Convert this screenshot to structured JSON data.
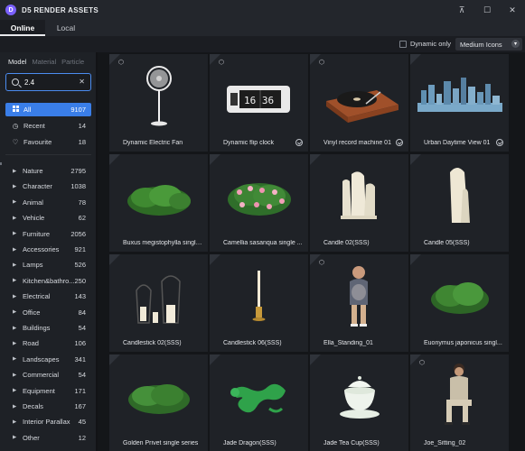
{
  "app": {
    "title": "D5 RENDER ASSETS",
    "logo_letter": "D"
  },
  "window_controls": {
    "pin": "⊼",
    "maximize": "☐",
    "close": "✕"
  },
  "tabs": [
    {
      "label": "Online"
    },
    {
      "label": "Local"
    }
  ],
  "toolbar": {
    "dynamic_only_label": "Dynamic only",
    "view_size": "Medium Icons"
  },
  "sidebar": {
    "subtabs": [
      "Model",
      "Material",
      "Particle"
    ],
    "search": {
      "value": "2.4"
    },
    "quick": [
      {
        "label": "All",
        "count": "9107"
      },
      {
        "label": "Recent",
        "count": "14"
      },
      {
        "label": "Favourite",
        "count": "18"
      }
    ],
    "categories": [
      {
        "label": "Nature",
        "count": "2795"
      },
      {
        "label": "Character",
        "count": "1038"
      },
      {
        "label": "Animal",
        "count": "78"
      },
      {
        "label": "Vehicle",
        "count": "62"
      },
      {
        "label": "Furniture",
        "count": "2056"
      },
      {
        "label": "Accessories",
        "count": "921"
      },
      {
        "label": "Lamps",
        "count": "526"
      },
      {
        "label": "Kitchen&bathro...",
        "count": "250"
      },
      {
        "label": "Electrical",
        "count": "143"
      },
      {
        "label": "Office",
        "count": "84"
      },
      {
        "label": "Buildings",
        "count": "54"
      },
      {
        "label": "Road",
        "count": "106"
      },
      {
        "label": "Landscapes",
        "count": "341"
      },
      {
        "label": "Commercial",
        "count": "54"
      },
      {
        "label": "Equipment",
        "count": "171"
      },
      {
        "label": "Decals",
        "count": "167"
      },
      {
        "label": "Interior Parallax",
        "count": "45"
      },
      {
        "label": "Other",
        "count": "12"
      }
    ]
  },
  "assets": [
    {
      "name": "Dynamic Electric Fan"
    },
    {
      "name": "Dynamic flip clock",
      "clock_text": "16 36"
    },
    {
      "name": "Vinyl record machine 01"
    },
    {
      "name": "Urban Daytime View 01"
    },
    {
      "name": "Buxus megistophylla single..."
    },
    {
      "name": "Camellia sasanqua single ..."
    },
    {
      "name": "Candle 02(SSS)"
    },
    {
      "name": "Candle 05(SSS)"
    },
    {
      "name": "Candlestick 02(SSS)"
    },
    {
      "name": "Candlestick 06(SSS)"
    },
    {
      "name": "Ella_Standing_01"
    },
    {
      "name": "Euonymus japonicus singl..."
    },
    {
      "name": "Golden Privet single series"
    },
    {
      "name": "Jade Dragon(SSS)"
    },
    {
      "name": "Jade Tea Cup(SSS)"
    },
    {
      "name": "Joe_Sitting_02"
    }
  ]
}
